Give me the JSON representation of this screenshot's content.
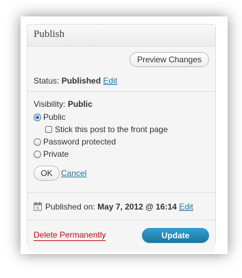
{
  "box": {
    "title": "Publish"
  },
  "preview": {
    "label": "Preview Changes"
  },
  "status": {
    "label": "Status:",
    "value": "Published",
    "edit": "Edit"
  },
  "visibility": {
    "label": "Visibility:",
    "value": "Public",
    "options": {
      "public": "Public",
      "sticky": "Stick this post to the front page",
      "password": "Password protected",
      "private": "Private"
    },
    "selected": "Public",
    "ok": "OK",
    "cancel": "Cancel"
  },
  "published": {
    "label": "Published on:",
    "value": "May 7, 2012 @ 16:14",
    "edit": "Edit",
    "icon": "calendar-icon"
  },
  "footer": {
    "delete": "Delete Permanently",
    "update": "Update"
  },
  "colors": {
    "link": "#21759b",
    "delete": "#bc0b0b",
    "update_bg": "#21759b"
  }
}
